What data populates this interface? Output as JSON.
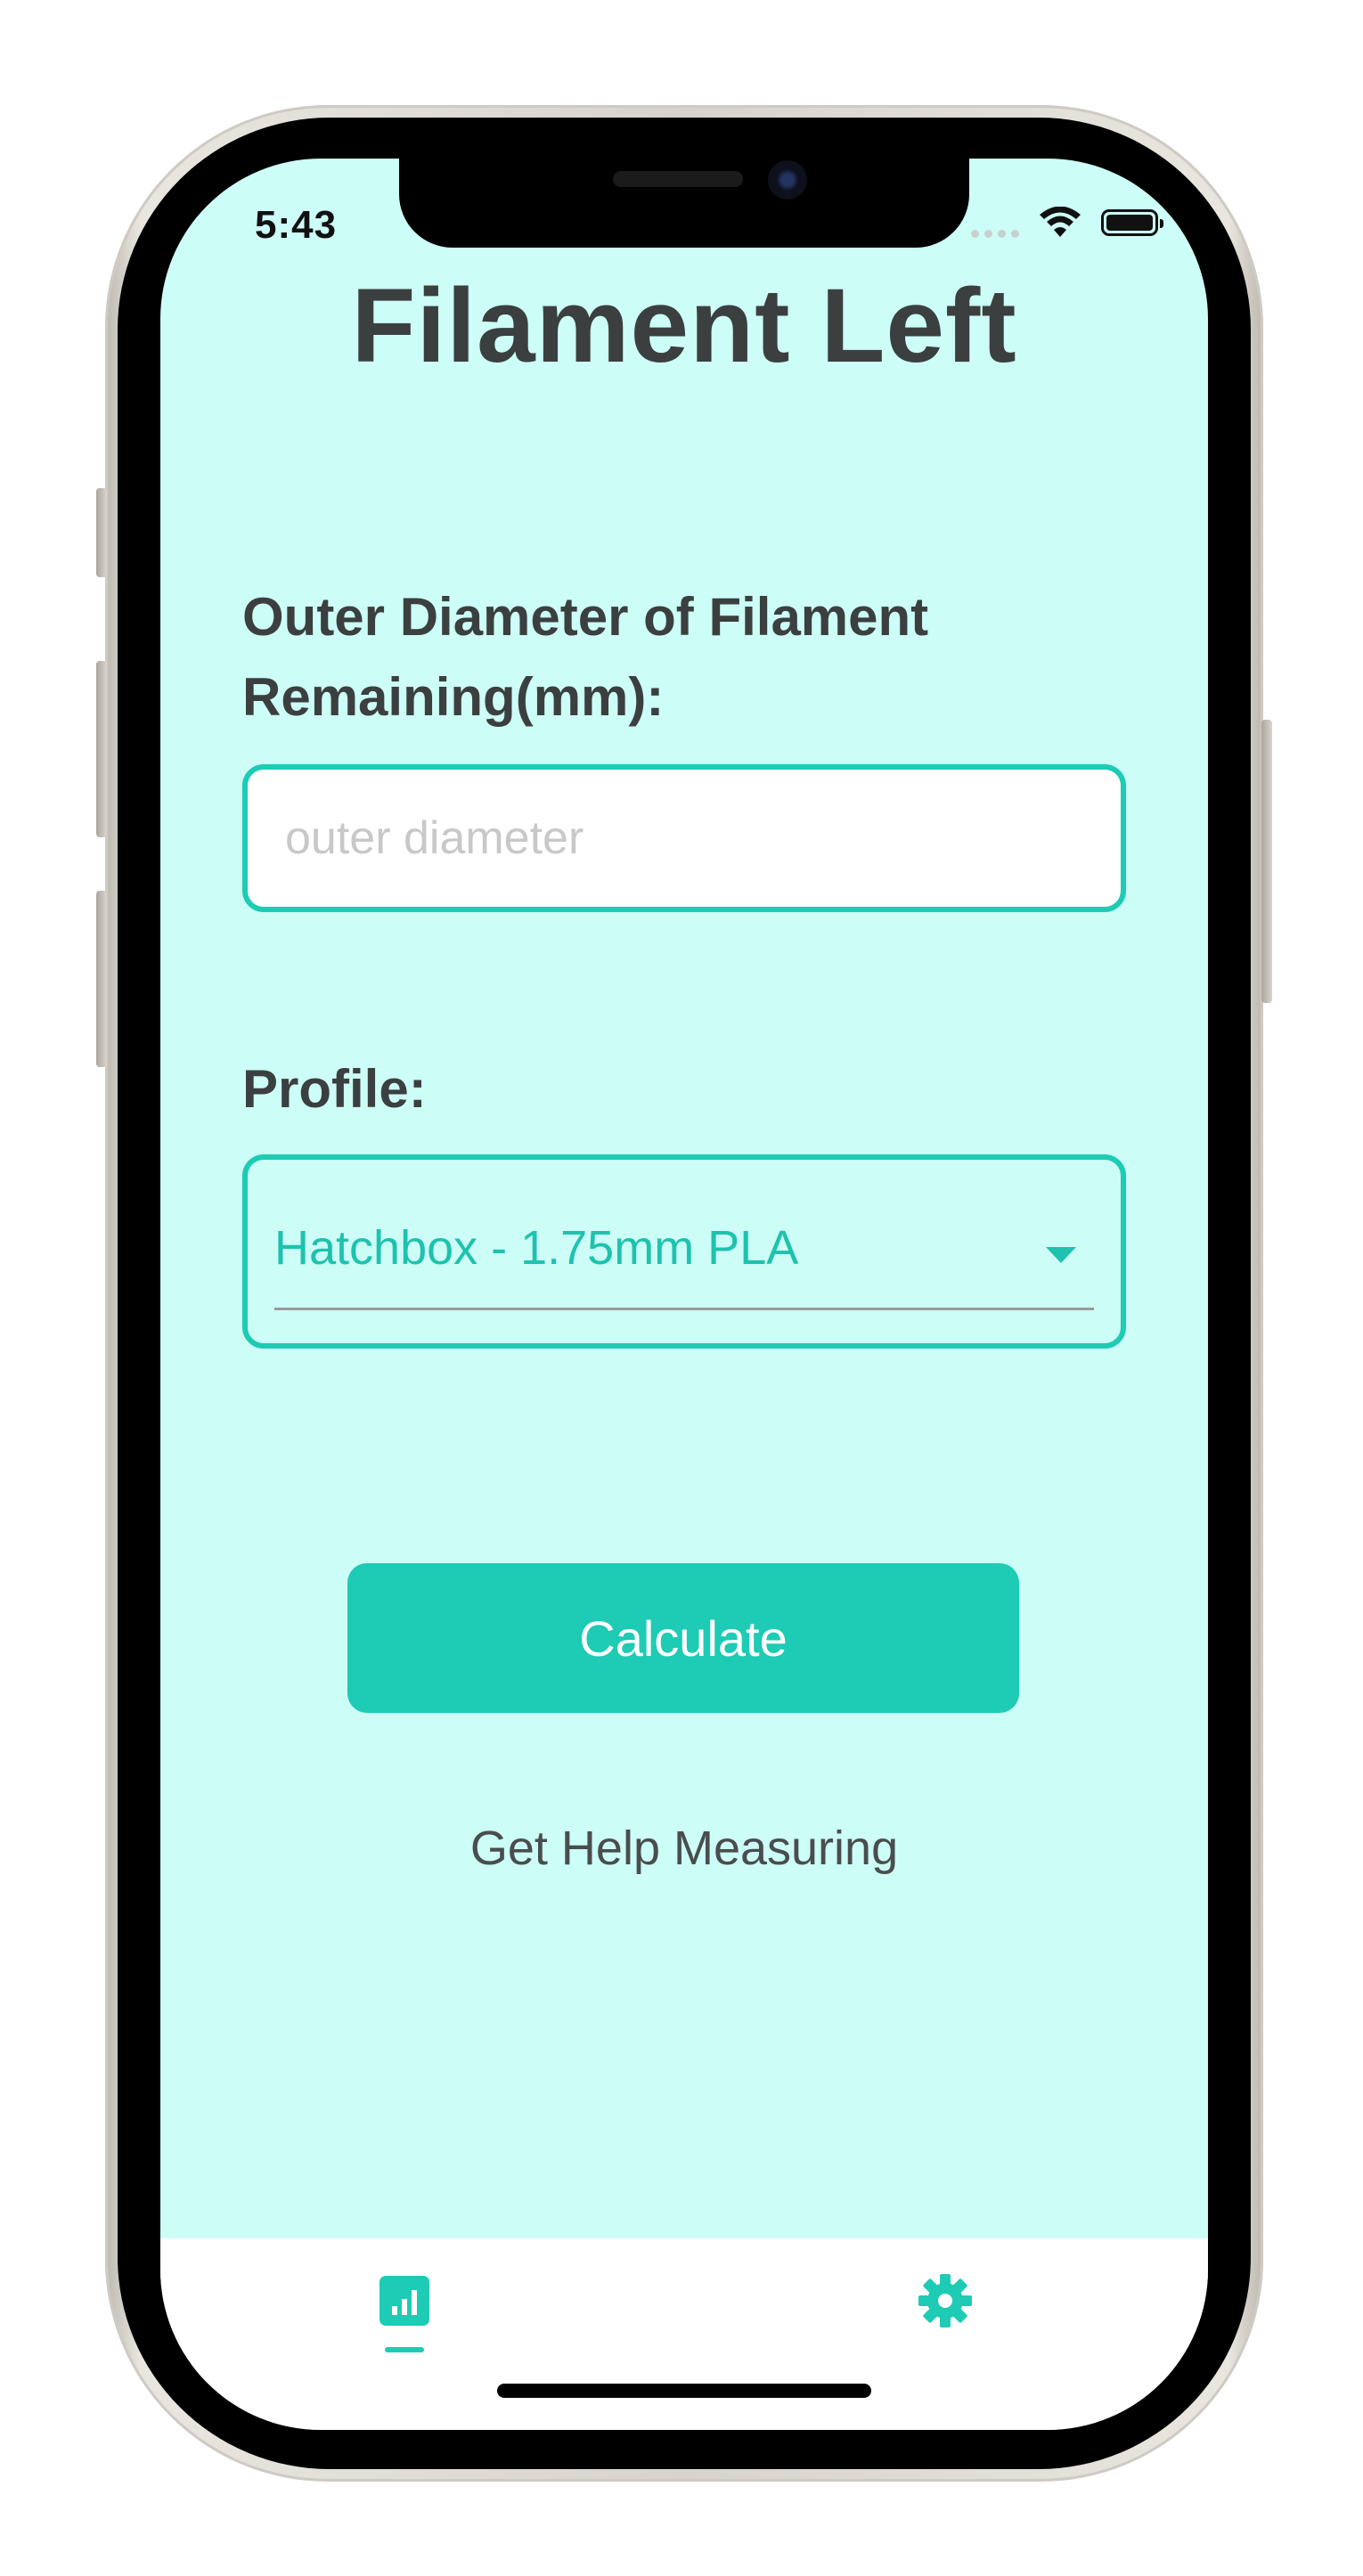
{
  "status_bar": {
    "time": "5:43",
    "icons": [
      "cellular-dots-icon",
      "wifi-icon",
      "battery-icon"
    ]
  },
  "page": {
    "title": "Filament Left"
  },
  "form": {
    "diameter_label": "Outer Diameter of Filament Remaining(mm):",
    "diameter_placeholder": "outer diameter",
    "diameter_value": "",
    "profile_label": "Profile:",
    "profile_selected": "Hatchbox - 1.75mm PLA",
    "calculate_label": "Calculate",
    "help_link": "Get Help Measuring"
  },
  "tab_bar": {
    "tabs": [
      {
        "icon": "bar-chart-icon",
        "active": true
      },
      {
        "icon": "gear-icon",
        "active": false
      }
    ]
  },
  "colors": {
    "background": "#ccfdf6",
    "accent": "#1ecbb4",
    "text_dark": "#3b3f40",
    "tab_bar_bg": "#ffffff"
  }
}
